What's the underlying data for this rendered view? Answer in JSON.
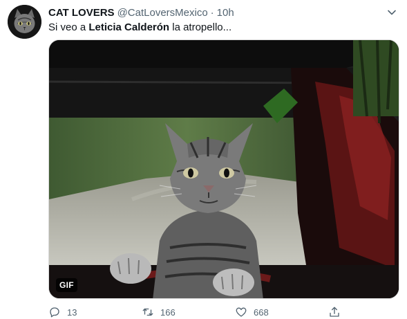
{
  "tweet": {
    "author_name": "CAT LOVERS",
    "handle": "@CatLoversMexico",
    "separator": "·",
    "time": "10h",
    "text_before": "Si veo a ",
    "text_bold": "Leticia Calderón",
    "text_after": " la atropello..."
  },
  "media": {
    "badge": "GIF"
  },
  "actions": {
    "replies": "13",
    "retweets": "166",
    "likes": "668"
  },
  "icons": {
    "more": "chevron-down-icon",
    "reply": "reply-icon",
    "retweet": "retweet-icon",
    "like": "heart-icon",
    "share": "share-icon"
  },
  "colors": {
    "text": "#0f1419",
    "secondary": "#536471"
  }
}
